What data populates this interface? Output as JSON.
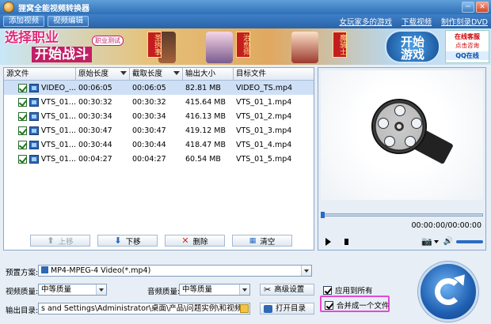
{
  "window": {
    "title": "狸窝全能视频转换器",
    "minimize_glyph": "─",
    "close_glyph": "✕"
  },
  "navbar": {
    "tabs": [
      "添加视频",
      "视频编辑"
    ],
    "links": [
      "女玩家多的游戏",
      "下载视频",
      "制作刻录DVD"
    ]
  },
  "banner": {
    "slogan_line1": "选择职业",
    "slogan_line2": "开始战斗",
    "tag": "职业测试",
    "hero_labels": [
      "圣执事",
      "治愈师",
      "魔骑士"
    ],
    "play_button": [
      "开始",
      "游戏"
    ],
    "service": {
      "title": "在线客服",
      "subtitle": "点击咨询",
      "qq": "QQ在线"
    }
  },
  "file_list": {
    "columns": [
      "源文件",
      "原始长度",
      "截取长度",
      "输出大小",
      "目标文件"
    ],
    "rows": [
      {
        "source": "VIDEO_...",
        "original": "00:06:05",
        "clip": "00:06:05",
        "size": "82.81 MB",
        "target": "VIDEO_TS.mp4"
      },
      {
        "source": "VTS_01...",
        "original": "00:30:32",
        "clip": "00:30:32",
        "size": "415.64 MB",
        "target": "VTS_01_1.mp4"
      },
      {
        "source": "VTS_01...",
        "original": "00:30:34",
        "clip": "00:30:34",
        "size": "416.13 MB",
        "target": "VTS_01_2.mp4"
      },
      {
        "source": "VTS_01...",
        "original": "00:30:47",
        "clip": "00:30:47",
        "size": "419.12 MB",
        "target": "VTS_01_3.mp4"
      },
      {
        "source": "VTS_01...",
        "original": "00:30:44",
        "clip": "00:30:44",
        "size": "418.47 MB",
        "target": "VTS_01_4.mp4"
      },
      {
        "source": "VTS_01...",
        "original": "00:04:27",
        "clip": "00:04:27",
        "size": "60.54 MB",
        "target": "VTS_01_5.mp4"
      }
    ],
    "toolbar": {
      "up": "上移",
      "down": "下移",
      "delete": "删除",
      "clear": "清空"
    }
  },
  "preview": {
    "time": "00:00:00/00:00:00",
    "icons": [
      "play-icon",
      "stop-icon",
      "camera-icon",
      "speaker-icon"
    ]
  },
  "settings": {
    "preset_label": "预置方案:",
    "preset_value": "MP4-MPEG-4 Video(*.mp4)",
    "video_quality_label": "视频质量:",
    "video_quality_value": "中等质量",
    "audio_quality_label": "音频质量:",
    "audio_quality_value": "中等质量",
    "advanced_button": "高级设置",
    "apply_all_label": "应用到所有",
    "output_label": "输出目录:",
    "output_path": "s and Settings\\Administrator\\桌面\\产品\\问题实例\\和视频原件\\转换",
    "open_dir_button": "打开目录",
    "merge_label": "合并成一个文件"
  },
  "colors": {
    "titlebar": "#2f6fb6",
    "selection": "#cfe0f6",
    "merge_highlight": "#e44ad4",
    "convert_button": "#1f5fb2"
  }
}
